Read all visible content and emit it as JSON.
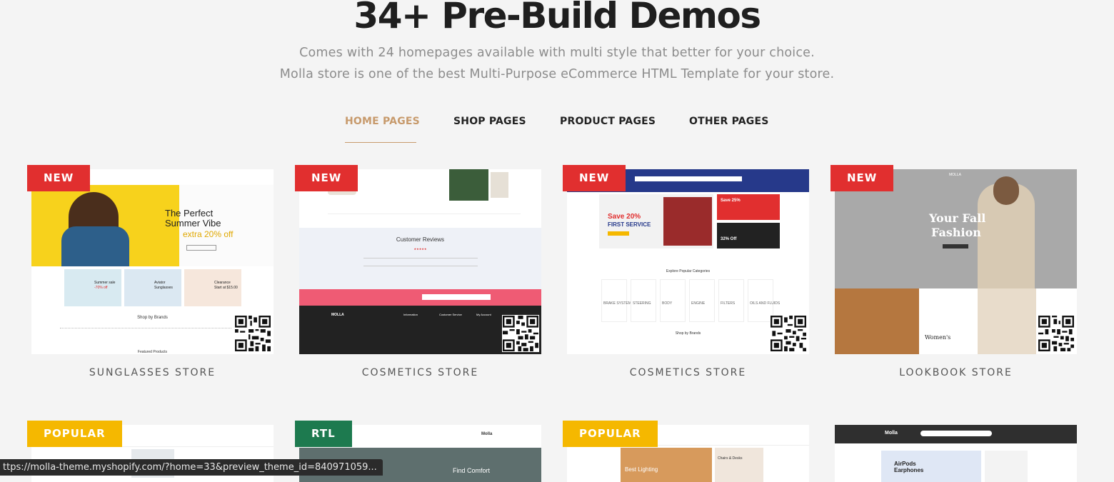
{
  "section": {
    "title": "34+ Pre-Build Demos",
    "subtitle_line1": "Comes with 24 homepages available with multi style that better for your choice.",
    "subtitle_line2": "Molla store is one of the best Multi-Purpose eCommerce HTML Template for your store."
  },
  "tabs": [
    {
      "label": "HOME PAGES",
      "active": true
    },
    {
      "label": "SHOP PAGES",
      "active": false
    },
    {
      "label": "PRODUCT PAGES",
      "active": false
    },
    {
      "label": "OTHER PAGES",
      "active": false
    }
  ],
  "demos": [
    {
      "badge": "NEW",
      "name": "SUNGLASSES STORE",
      "hero_line1": "The Perfect",
      "hero_line2": "Summer Vibe",
      "hero_line3": "extra 20% off",
      "promo1": "Summer sale",
      "promo1b": "-70% off",
      "promo2": "Aviator",
      "promo2b": "Sunglasses",
      "promo3": "Clearance",
      "promo3b": "Start at $15.00",
      "brands": "Shop by Brands",
      "featured": "Featured Products"
    },
    {
      "badge": "NEW",
      "name": "COSMETICS STORE",
      "reviews": "Customer Reviews",
      "footer_logo": "MOLLA",
      "footer_info": "Information",
      "footer_service": "Customer Service",
      "footer_account": "My Account"
    },
    {
      "badge": "NEW",
      "name": "COSMETICS STORE",
      "hero_line1": "Save 20%",
      "hero_line2": "FIRST SERVICE",
      "side1": "Save 25%",
      "side1b": "32% Off",
      "categories": "Explore Popular Categories",
      "brands": "Shop by Brands",
      "cats": [
        "BRAKE SYSTEM",
        "STEERING",
        "BODY",
        "ENGINE",
        "FILTERS",
        "OILS AND FLUIDS"
      ]
    },
    {
      "badge": "NEW",
      "name": "LOOKBOOK STORE",
      "logo": "MOLLA",
      "hero_line1": "Your Fall",
      "hero_line2": "Fashion",
      "women": "Women's"
    }
  ],
  "demos_row2": [
    {
      "badge": "POPULAR"
    },
    {
      "badge": "RTL",
      "logo": "Molla",
      "hero": "Find Comfort"
    },
    {
      "badge": "POPULAR",
      "hero": "Best Lighting",
      "side": "Chairs & Desks"
    },
    {
      "badge": "",
      "logo": "Molla",
      "hero": "AirPods Earphones"
    }
  ],
  "status_bar": {
    "url": "ttps://molla-theme.myshopify.com/?home=33&preview_theme_id=840971059..."
  },
  "colors": {
    "accent": "#c79a6c",
    "badge_new": "#e12f2f",
    "badge_popular": "#f5b800",
    "badge_rtl": "#1d7a4f",
    "text_dark": "#222222",
    "text_muted": "#8c8c8c"
  }
}
